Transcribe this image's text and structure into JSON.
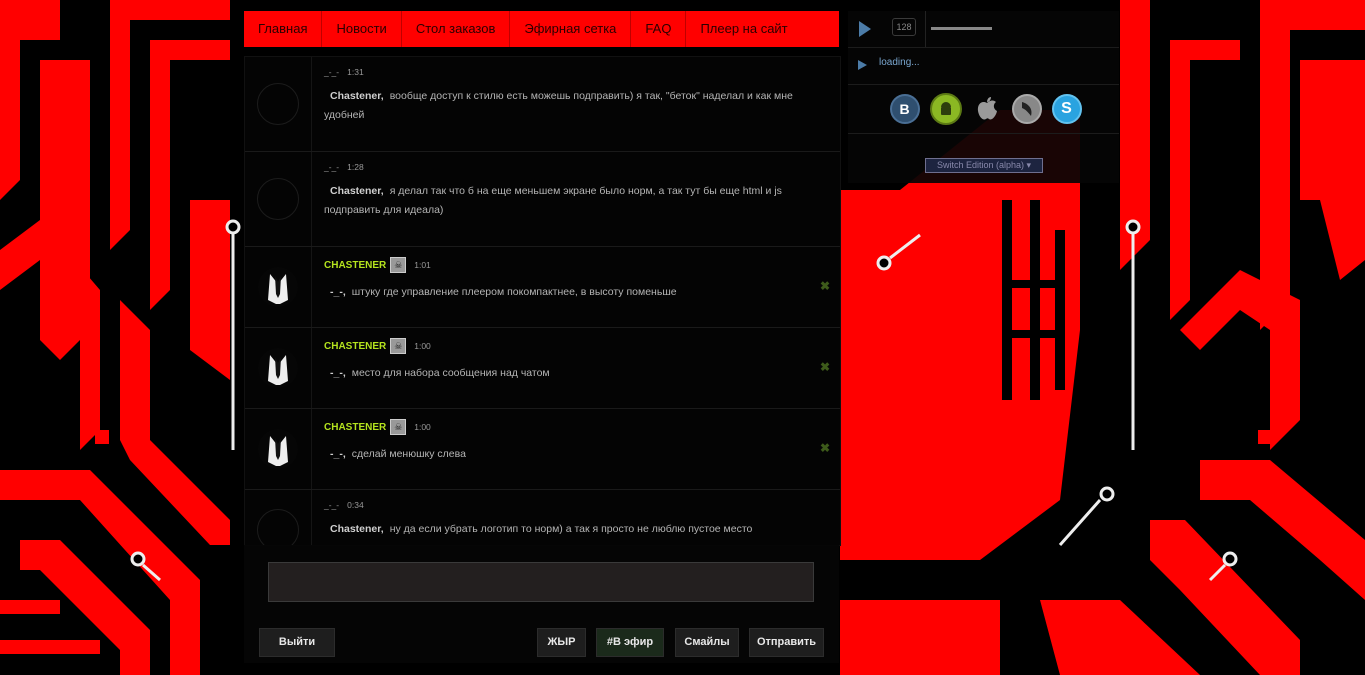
{
  "nav": {
    "items": [
      "Главная",
      "Новости",
      "Стол заказов",
      "Эфирная сетка",
      "FAQ",
      "Плеер на сайт"
    ]
  },
  "chat": {
    "messages": [
      {
        "user": "_-_-",
        "time": "1:31",
        "to": "Chastener,",
        "text": "вообще доступ к стилю есть можешь подправить) я так, \"беток\" наделал и как мне удобней"
      },
      {
        "user": "_-_-",
        "time": "1:28",
        "to": "Chastener,",
        "text": "я делал так что б на еще меньшем экране было норм, а так тут бы еще html и js подправить для идеала)"
      },
      {
        "user": "CHASTENER",
        "time": "1:01",
        "to": "-_-,",
        "text": "штуку где управление плеером покомпактнее, в высоту поменьше"
      },
      {
        "user": "CHASTENER",
        "time": "1:00",
        "to": "-_-,",
        "text": "место для набора сообщения над чатом"
      },
      {
        "user": "CHASTENER",
        "time": "1:00",
        "to": "-_-,",
        "text": "сделай менюшку слева"
      },
      {
        "user": "_-_-",
        "time": "0:34",
        "to": "Chastener,",
        "text": "ну да если убрать логотип то норм) а так я просто не люблю пустое место"
      }
    ],
    "delete_glyph": "✖",
    "accent_color": "#b5e41e"
  },
  "composer": {
    "input_value": "",
    "buttons": {
      "logout": "Выйти",
      "bold": "ЖЫР",
      "on_air": "#В эфир",
      "smileys": "Смайлы",
      "send": "Отправить"
    }
  },
  "player": {
    "bitrate": "128",
    "status": "loading...",
    "volume": 0.55,
    "icons": [
      "vk-icon",
      "android-icon",
      "apple-icon",
      "winamp-icon",
      "skype-icon"
    ],
    "switch_label": "Switch Edition (alpha) ▾"
  },
  "theme": {
    "accent": "#ff0000",
    "background": "#000000"
  }
}
